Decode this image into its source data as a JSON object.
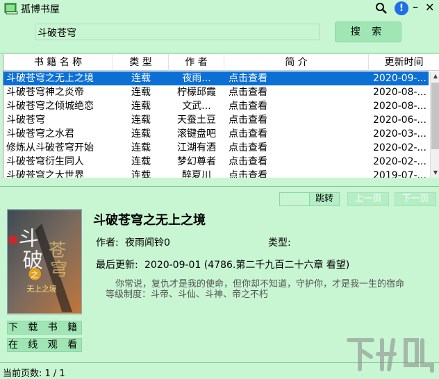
{
  "window": {
    "title": "孤博书屋"
  },
  "search": {
    "value": "斗破苍穹",
    "button_label": "搜 索"
  },
  "table": {
    "columns": [
      "书 籍 名 称",
      "类 型",
      "作 者",
      "简 介",
      "更新时间"
    ],
    "rows": [
      [
        "斗破苍穹之无上之境",
        "连载",
        "夜雨...",
        "点击查看",
        "2020-09-..."
      ],
      [
        "斗破苍穹神之炎帝",
        "连载",
        "柠檬邱霞",
        "点击查看",
        "2020-08-..."
      ],
      [
        "斗破苍穹之倾城绝恋",
        "连载",
        "文武...",
        "点击查看",
        "2020-08-..."
      ],
      [
        "斗破苍穹",
        "连载",
        "天蚕土豆",
        "点击查看",
        "2020-06-..."
      ],
      [
        "斗破苍穹之水君",
        "连载",
        "滚键盘吧",
        "点击查看",
        "2020-03-..."
      ],
      [
        "修炼从斗破苍穹开始",
        "连载",
        "江湖有酒",
        "点击查看",
        "2020-02-..."
      ],
      [
        "斗破苍穹衍生同人",
        "连载",
        "梦幻尊者",
        "点击查看",
        "2020-02-..."
      ],
      [
        "斗破苍穹之大世界",
        "连载",
        "醉夏川",
        "点击查看",
        "2019-07-..."
      ]
    ],
    "selected_index": 0
  },
  "pager": {
    "jump_label": "跳转",
    "prev_label": "上一页",
    "next_label": "下一页"
  },
  "detail": {
    "title": "斗破苍穹之无上之境",
    "author_label": "作者:",
    "author": "夜雨闻铃0",
    "type_label": "类型:",
    "update_label": "最后更新:",
    "update_value": "2020-09-01  (4786.第二千九百二十六章 看望)",
    "desc_lines": [
      "你常说，复仇才是我的使命，但你却不知道，守护你，才是我一生的宿命",
      "等级制度：斗帝、斗仙、斗神、帝之不朽"
    ],
    "cover_text": [
      "斗",
      "破",
      "苍",
      "穹",
      "之",
      "无上之境"
    ]
  },
  "actions": {
    "download_label": "下 载 书 籍",
    "online_label": "在 线 观 看"
  },
  "status": {
    "page_text": "当前页数: 1 / 1"
  },
  "watermark": {
    "text": "下载吧"
  },
  "colors": {
    "background": "#c8f5d2",
    "selection": "#0b6fd6",
    "button": "#9fe6b4"
  }
}
